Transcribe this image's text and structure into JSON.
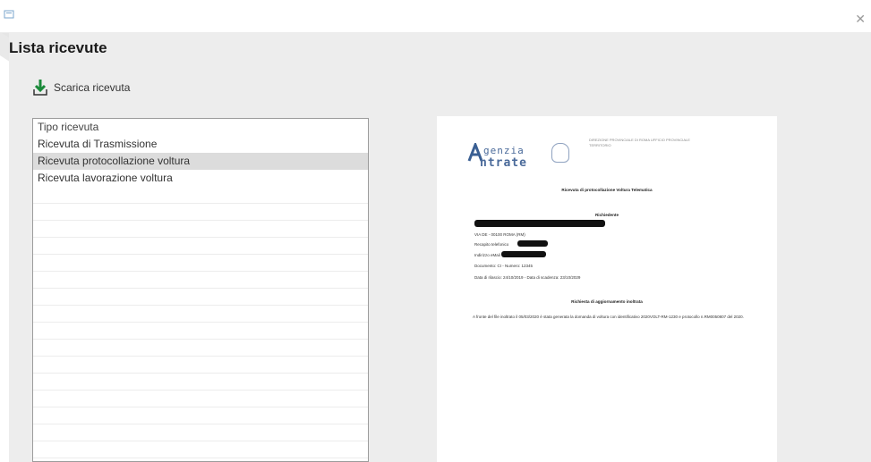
{
  "window": {
    "close_glyph": "✕"
  },
  "page": {
    "title": "Lista ricevute"
  },
  "toolbar": {
    "download_label": "Scarica ricevuta",
    "download_icon": "download-icon",
    "accent": "#1a8a3a"
  },
  "receipts_list": {
    "header": "Tipo ricevuta",
    "items": [
      "Ricevuta di Trasmissione",
      "Ricevuta protocollazione voltura",
      "Ricevuta lavorazione voltura"
    ],
    "selected_index": 1
  },
  "preview": {
    "logo_line1": "genzia",
    "logo_line2": "ntrate",
    "header_text": "DIREZIONE PROVINCIALE DI ROMA UFFICIO PROVINCIALE TERRITORIO",
    "doc_title": "Ricevuta di protocollazione Voltura Telematica",
    "section_applicant": "Richiedente",
    "address": "VIA DE - 00100 ROMA (RM)",
    "phone_label": "Recapito telefonico",
    "email_label": "Indirizzo eMail",
    "document_line": "Documento: CI - Numero: 12345",
    "dates_line": "Data di rilascio: 24/10/2019 - Data di scadenza: 23/10/2029",
    "section_request": "Richiesta di aggiornamento inoltrata",
    "request_text": "A fronte del file inoltrato il 05/03/2020 è stata generata la domanda di voltura con identificativo 2020VOLT-RM-1230 e protocollo n.RM0050807 del 2020."
  }
}
